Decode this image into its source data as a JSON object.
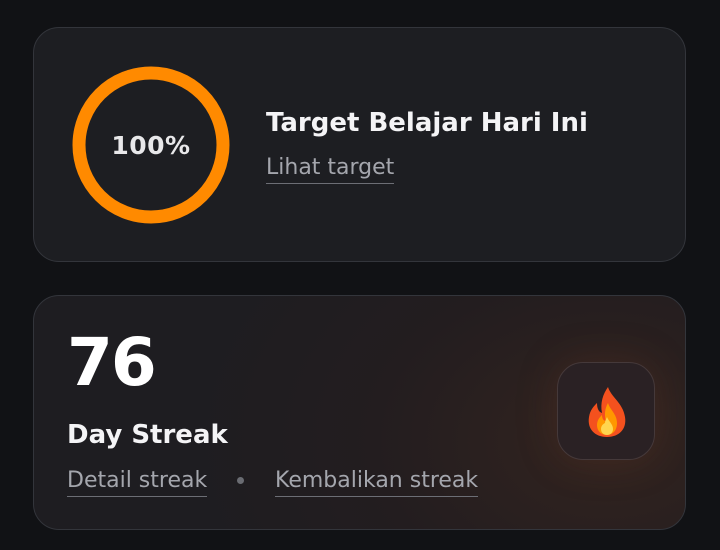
{
  "target_card": {
    "progress_percent": 100,
    "progress_label": "100%",
    "title": "Target Belajar Hari Ini",
    "link_label": "Lihat target",
    "ring_color": "#ff8a00"
  },
  "streak_card": {
    "count": "76",
    "label": "Day Streak",
    "detail_link": "Detail streak",
    "restore_link": "Kembalikan streak",
    "icon": "fire-icon"
  }
}
